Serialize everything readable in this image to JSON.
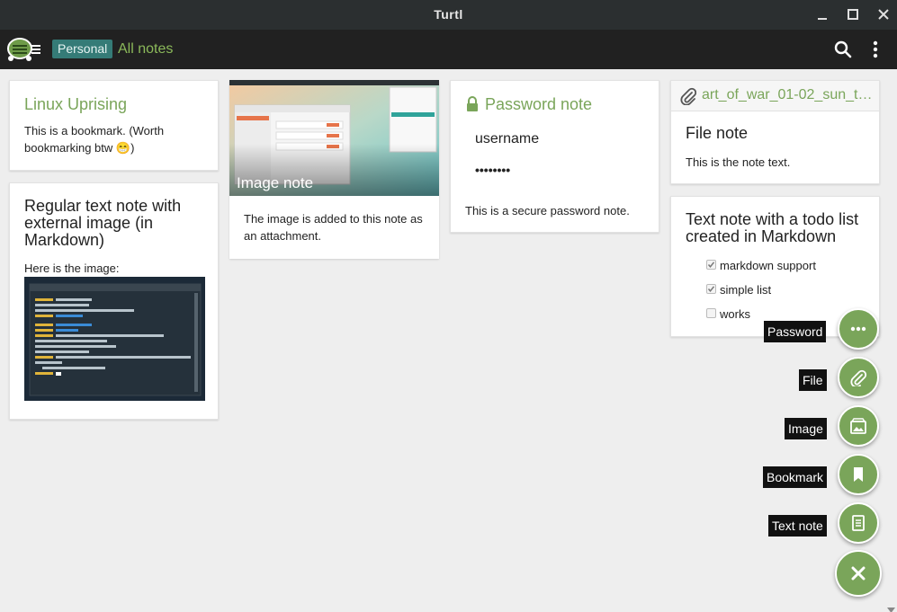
{
  "window": {
    "title": "Turtl"
  },
  "header": {
    "space": "Personal",
    "all_notes": "All notes"
  },
  "notes": {
    "bookmark": {
      "title": "Linux Uprising",
      "text": "This is a bookmark. (Worth bookmarking btw 😁)"
    },
    "markdown_image": {
      "title": "Regular text note with external image (in Markdown)",
      "text": "Here is the image:"
    },
    "image": {
      "caption": "Image note",
      "text": "The image is added to this note as an attachment."
    },
    "password": {
      "title": "Password note",
      "username": "username",
      "password": "••••••••",
      "text": "This is a secure password note."
    },
    "file": {
      "filename": "art_of_war_01-02_sun_t…",
      "title": "File note",
      "text": "This is the note text."
    },
    "todo": {
      "title": "Text note with a todo list created in Markdown",
      "items": [
        {
          "label": "markdown support",
          "checked": true
        },
        {
          "label": "simple list",
          "checked": true
        },
        {
          "label": "works",
          "checked": false
        }
      ]
    }
  },
  "fab_menu": {
    "password": "Password",
    "file": "File",
    "image": "Image",
    "bookmark": "Bookmark",
    "text_note": "Text note"
  },
  "colors": {
    "accent": "#7aa55a",
    "space_badge": "#357b77",
    "header": "#212121"
  }
}
